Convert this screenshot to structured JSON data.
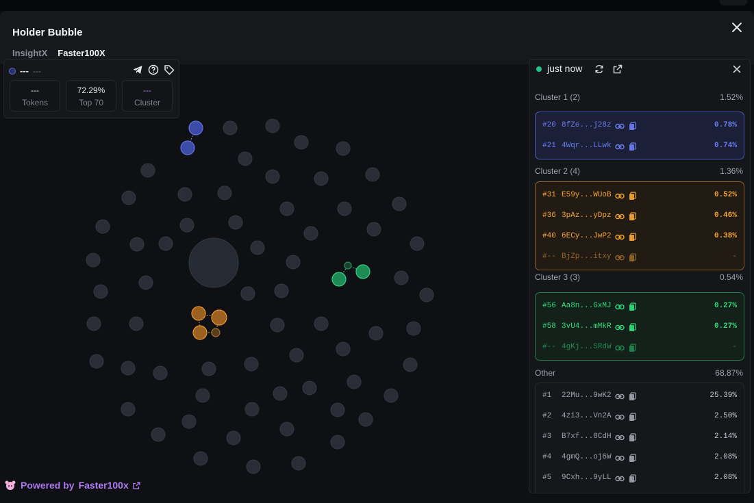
{
  "header": {
    "title": "Holder Bubble",
    "tabs": [
      {
        "label": "InsightX"
      },
      {
        "label": "Faster100X"
      }
    ]
  },
  "stats": {
    "symbol": "---",
    "name": "---",
    "tokens_value": "---",
    "tokens_label": "Tokens",
    "top_value": "72.29%",
    "top_label": "Top 70",
    "cluster_value": "---",
    "cluster_label": "Cluster"
  },
  "panel": {
    "updated": "just now",
    "clusters": [
      {
        "title": "Cluster 1 (2)",
        "percent": "1.52%",
        "color": "#6b7ef0",
        "border": "#4c59b4",
        "bg": "#1b1f38",
        "rows": [
          {
            "rank": "#20",
            "address": "8fZe...j28z",
            "percent": "0.78%"
          },
          {
            "rank": "#21",
            "address": "4Wqr...LLwk",
            "percent": "0.74%"
          }
        ]
      },
      {
        "title": "Cluster 2 (4)",
        "percent": "1.36%",
        "color": "#f3a437",
        "border": "#8f6226",
        "bg": "#221b14",
        "rows": [
          {
            "rank": "#31",
            "address": "E59y...WUoB",
            "percent": "0.52%"
          },
          {
            "rank": "#36",
            "address": "3pAz...yDpz",
            "percent": "0.46%"
          },
          {
            "rank": "#40",
            "address": "6ECy...JwP2",
            "percent": "0.38%"
          },
          {
            "rank": "#--",
            "address": "BjZp...itxy",
            "percent": "-",
            "dim": true
          }
        ]
      },
      {
        "title": "Cluster 3 (3)",
        "percent": "0.54%",
        "color": "#2fdb7a",
        "border": "#23784a",
        "bg": "#14211a",
        "rows": [
          {
            "rank": "#56",
            "address": "Aa8n...GxMJ",
            "percent": "0.27%"
          },
          {
            "rank": "#58",
            "address": "3vU4...mMkR",
            "percent": "0.27%"
          },
          {
            "rank": "#--",
            "address": "4gKj...SRdW",
            "percent": "-",
            "dim": true
          }
        ]
      }
    ],
    "other": {
      "title": "Other",
      "percent": "68.87%",
      "rows": [
        {
          "rank": "#1",
          "address": "22Mu...9wK2",
          "percent": "25.39%"
        },
        {
          "rank": "#2",
          "address": "4zi3...Vn2A",
          "percent": "2.50%"
        },
        {
          "rank": "#3",
          "address": "B7xf...8CdH",
          "percent": "2.14%"
        },
        {
          "rank": "#4",
          "address": "4gmQ...oj6W",
          "percent": "2.08%"
        },
        {
          "rank": "#5",
          "address": "9Cxh...9yLL",
          "percent": "2.08%"
        }
      ]
    }
  },
  "footer": {
    "prefix": "Powered by",
    "brand": "Faster100x"
  },
  "colors": {
    "accent": "#b27cf6",
    "cluster1": "#6b7ef0",
    "cluster2": "#f3a437",
    "cluster3": "#2fdb7a",
    "live": "#1fc38a"
  }
}
